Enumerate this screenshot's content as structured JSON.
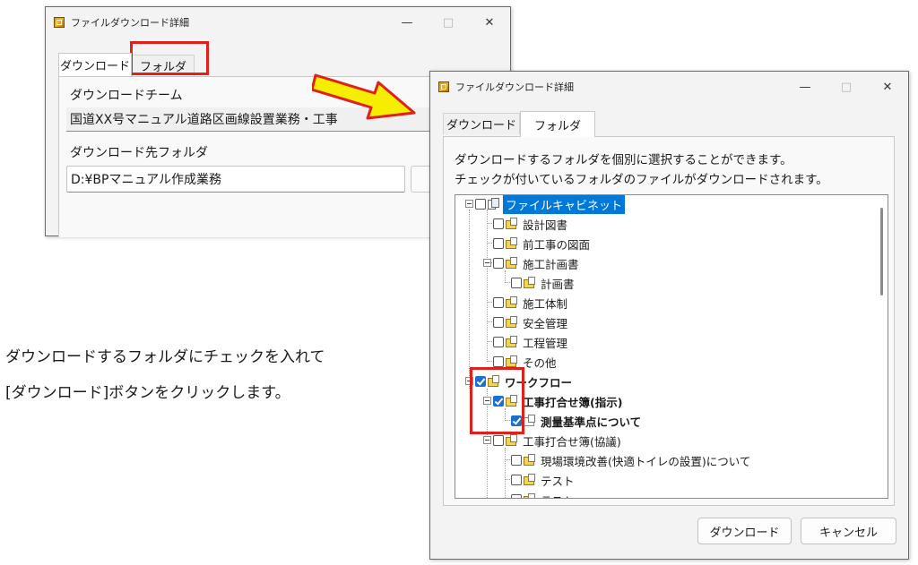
{
  "window_title": "ファイルダウンロード詳細",
  "titlebar_buttons": {
    "minimize": "—",
    "maximize": "□",
    "close": "✕"
  },
  "tabs": {
    "download": "ダウンロード",
    "folder": "フォルダ"
  },
  "back_window": {
    "team_label": "ダウンロードチーム",
    "team_value": "国道XX号マニュアル道路区画線設置業務・工事",
    "dest_label": "ダウンロード先フォルダ",
    "dest_value": "D:¥BPマニュアル作成業務"
  },
  "front_window": {
    "desc_line1": "ダウンロードするフォルダを個別に選択することができます。",
    "desc_line2": "チェックが付いているフォルダのファイルがダウンロードされます。",
    "tree": [
      {
        "label": "ファイルキャビネット",
        "checked": false
      },
      {
        "label": "設計図書",
        "checked": false
      },
      {
        "label": "前工事の図面",
        "checked": false
      },
      {
        "label": "施工計画書",
        "checked": false
      },
      {
        "label": "計画書",
        "checked": false
      },
      {
        "label": "施工体制",
        "checked": false
      },
      {
        "label": "安全管理",
        "checked": false
      },
      {
        "label": "工程管理",
        "checked": false
      },
      {
        "label": "その他",
        "checked": false
      },
      {
        "label": "ワークフロー",
        "checked": true
      },
      {
        "label": "工事打合せ簿(指示)",
        "checked": true
      },
      {
        "label": "測量基準点について",
        "checked": true
      },
      {
        "label": "工事打合せ簿(協議)",
        "checked": false
      },
      {
        "label": "現場環境改善(快適トイレの設置)について",
        "checked": false
      },
      {
        "label": "テスト",
        "checked": false
      },
      {
        "label": "テスト",
        "checked": false
      }
    ],
    "download_button": "ダウンロード",
    "cancel_button": "キャンセル"
  },
  "instruction": {
    "line1": "ダウンロードするフォルダにチェックを入れて",
    "line2": "[ダウンロード]ボタンをクリックします。"
  },
  "colors": {
    "highlight": "#e0201a",
    "arrow_fill": "#f6ee00",
    "arrow_stroke": "#e0201a",
    "selection": "#0078d7",
    "checkbox": "#1a6fd1"
  }
}
